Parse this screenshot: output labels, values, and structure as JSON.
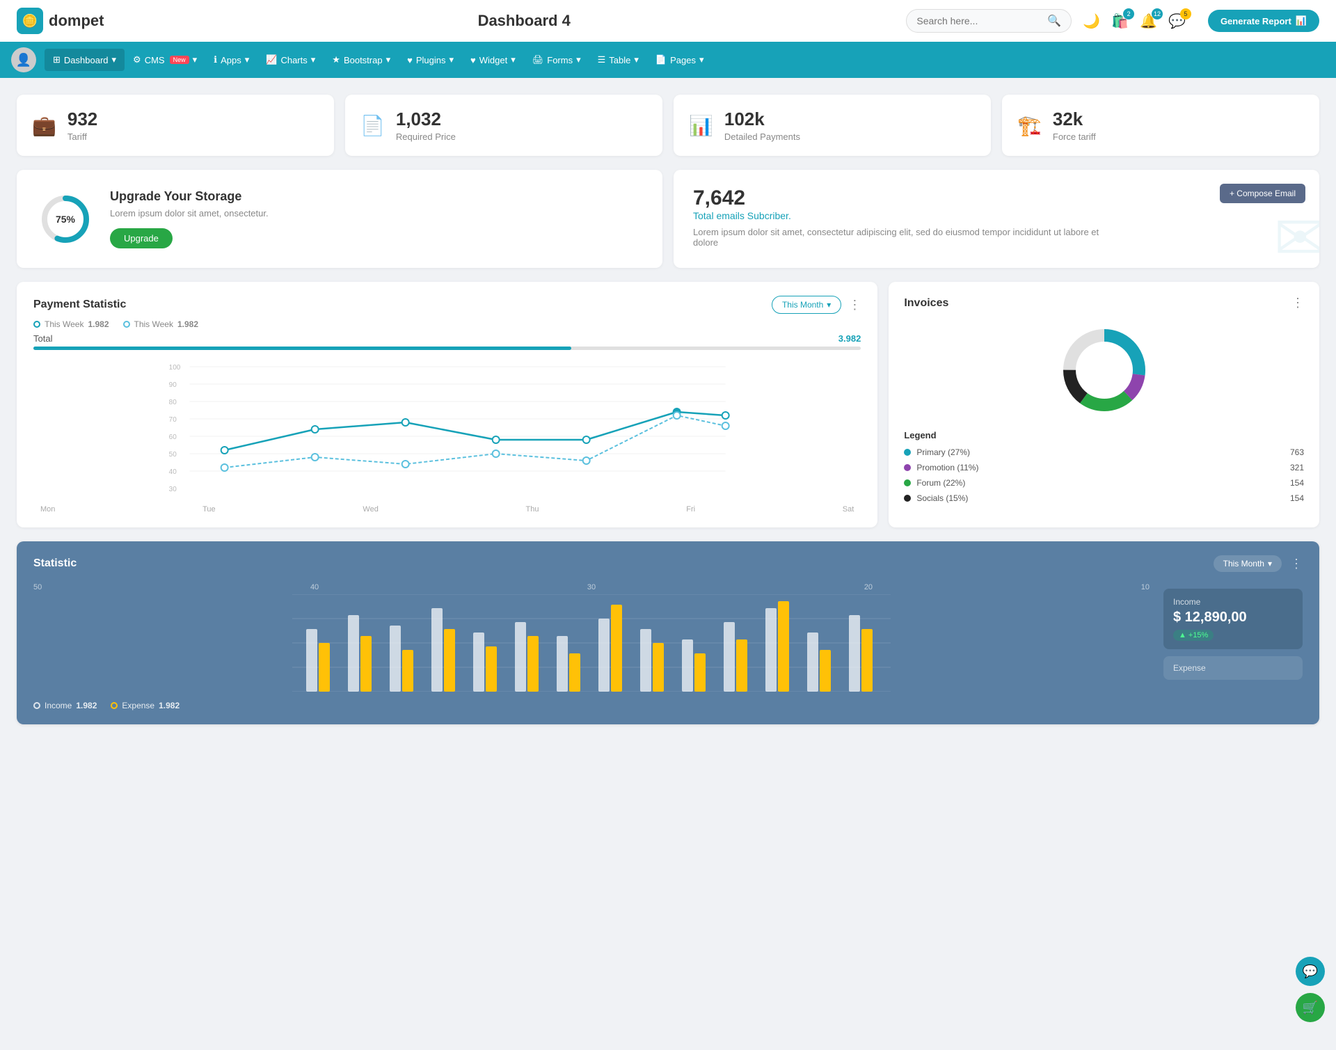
{
  "header": {
    "logo_text": "dompet",
    "page_title": "Dashboard 4",
    "search_placeholder": "Search here...",
    "generate_btn": "Generate Report",
    "icons": {
      "cart_badge": "2",
      "notification_badge": "12",
      "message_badge": "5"
    }
  },
  "nav": {
    "items": [
      {
        "label": "Dashboard",
        "icon": "grid",
        "active": true,
        "badge": ""
      },
      {
        "label": "CMS",
        "icon": "gear",
        "active": false,
        "badge": "New"
      },
      {
        "label": "Apps",
        "icon": "info",
        "active": false,
        "badge": ""
      },
      {
        "label": "Charts",
        "icon": "chart",
        "active": false,
        "badge": ""
      },
      {
        "label": "Bootstrap",
        "icon": "star",
        "active": false,
        "badge": ""
      },
      {
        "label": "Plugins",
        "icon": "heart",
        "active": false,
        "badge": ""
      },
      {
        "label": "Widget",
        "icon": "heart2",
        "active": false,
        "badge": ""
      },
      {
        "label": "Forms",
        "icon": "print",
        "active": false,
        "badge": ""
      },
      {
        "label": "Table",
        "icon": "table",
        "active": false,
        "badge": ""
      },
      {
        "label": "Pages",
        "icon": "file",
        "active": false,
        "badge": ""
      }
    ]
  },
  "stat_cards": [
    {
      "value": "932",
      "label": "Tariff",
      "icon": "💼",
      "color": "#17a2b8"
    },
    {
      "value": "1,032",
      "label": "Required Price",
      "icon": "📄",
      "color": "#e74c3c"
    },
    {
      "value": "102k",
      "label": "Detailed Payments",
      "icon": "📊",
      "color": "#8e44ad"
    },
    {
      "value": "32k",
      "label": "Force tariff",
      "icon": "🏗️",
      "color": "#e91e8c"
    }
  ],
  "storage": {
    "percent": "75%",
    "title": "Upgrade Your Storage",
    "description": "Lorem ipsum dolor sit amet, onsectetur.",
    "btn_label": "Upgrade",
    "donut_pct": 75
  },
  "email": {
    "number": "7,642",
    "subtitle": "Total emails Subcriber.",
    "description": "Lorem ipsum dolor sit amet, consectetur adipiscing elit, sed do eiusmod tempor incididunt ut labore et dolore",
    "compose_btn": "+ Compose Email"
  },
  "payment": {
    "title": "Payment Statistic",
    "this_month": "This Month",
    "legend1_label": "This Week",
    "legend1_value": "1.982",
    "legend2_label": "This Week",
    "legend2_value": "1.982",
    "total_label": "Total",
    "total_value": "3.982",
    "progress_pct": 65,
    "x_labels": [
      "Mon",
      "Tue",
      "Wed",
      "Thu",
      "Fri",
      "Sat"
    ],
    "y_labels": [
      "100",
      "90",
      "80",
      "70",
      "60",
      "50",
      "40",
      "30"
    ],
    "line1_points": "60,170 180,130 310,120 440,155 570,155 700,115 780,120",
    "line2_points": "60,195 180,175 310,185 440,170 570,180 700,120 780,130"
  },
  "invoices": {
    "title": "Invoices",
    "legend_title": "Legend",
    "items": [
      {
        "label": "Primary (27%)",
        "color": "#17a2b8",
        "value": "763"
      },
      {
        "label": "Promotion (11%)",
        "color": "#8e44ad",
        "value": "321"
      },
      {
        "label": "Forum (22%)",
        "color": "#28a745",
        "value": "154"
      },
      {
        "label": "Socials (15%)",
        "color": "#222",
        "value": "154"
      }
    ]
  },
  "statistic": {
    "title": "Statistic",
    "this_month": "This Month",
    "y_labels": [
      "50",
      "40",
      "30",
      "20",
      "10"
    ],
    "income_label": "Income",
    "income_value": "1.982",
    "expense_label": "Expense",
    "expense_value": "1.982",
    "income_box_label": "Income",
    "income_box_value": "$ 12,890,00",
    "income_badge": "+15%",
    "expense_box_label": "Expense"
  },
  "floating": {
    "support_icon": "💬",
    "cart_icon": "🛒"
  }
}
